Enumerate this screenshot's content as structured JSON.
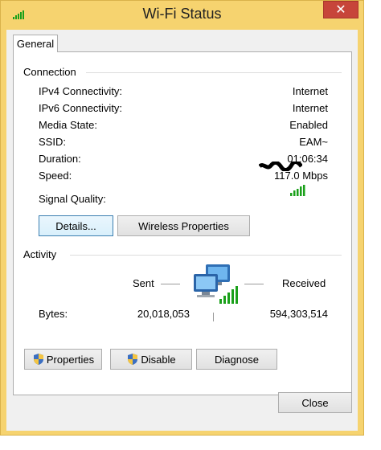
{
  "window": {
    "title": "Wi-Fi Status",
    "close_glyph": "✕",
    "colors": {
      "frame": "#f6d36f",
      "close": "#c7453a",
      "signal": "#1aa01a"
    }
  },
  "tabs": [
    {
      "label": "General",
      "selected": true
    }
  ],
  "connection": {
    "heading": "Connection",
    "rows": [
      {
        "label": "IPv4 Connectivity:",
        "value": "Internet"
      },
      {
        "label": "IPv6 Connectivity:",
        "value": "Internet"
      },
      {
        "label": "Media State:",
        "value": "Enabled"
      },
      {
        "label": "SSID:",
        "value": "EAM~"
      },
      {
        "label": "Duration:",
        "value": "01:06:34"
      },
      {
        "label": "Speed:",
        "value": "117.0 Mbps"
      }
    ],
    "signal_label": "Signal Quality:",
    "signal_bars_lit": 5,
    "signal_bars_total": 5
  },
  "buttons": {
    "details": "Details...",
    "wireless_properties": "Wireless Properties",
    "properties": "Properties",
    "disable": "Disable",
    "diagnose": "Diagnose",
    "close": "Close"
  },
  "activity": {
    "heading": "Activity",
    "sent_label": "Sent",
    "received_label": "Received",
    "bytes_label": "Bytes:",
    "bytes_sent": "20,018,053",
    "bytes_received": "594,303,514"
  }
}
